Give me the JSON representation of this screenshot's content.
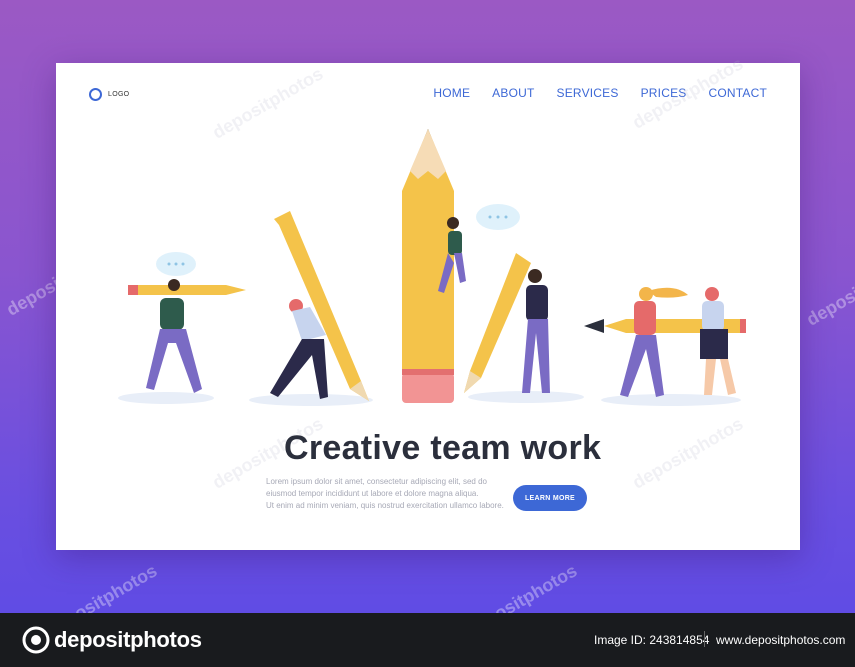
{
  "header": {
    "logo_text": "LOGO",
    "nav": [
      {
        "label": "HOME"
      },
      {
        "label": "ABOUT"
      },
      {
        "label": "SERVICES"
      },
      {
        "label": "PRICES"
      },
      {
        "label": "CONTACT"
      }
    ]
  },
  "hero": {
    "headline": "Creative team work",
    "body_lines": [
      "Lorem ipsum dolor sit amet, consectetur adipiscing elit, sed do",
      "eiusmod tempor incididunt ut labore et dolore magna aliqua.",
      "Ut enim ad minim veniam, quis nostrud exercitation ullamco labore."
    ],
    "cta_label": "LEARN MORE"
  },
  "footer_bar": {
    "brand": "depositphotos",
    "image_id": "Image ID: 243814854",
    "site": "www.depositphotos.com"
  },
  "watermark": "depositphotos",
  "colors": {
    "accent": "#3d68d6",
    "pencil": "#f4c34a",
    "background_top": "#9b59c4",
    "background_bottom": "#5b4ae6"
  }
}
